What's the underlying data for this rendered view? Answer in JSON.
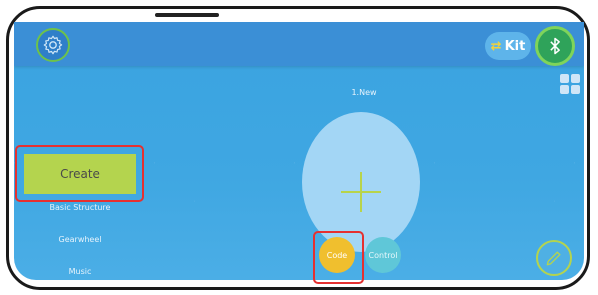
{
  "topbar": {
    "settings_icon": "gear-icon",
    "kit_label": "Kit",
    "kit_icon": "swap-arrows-icon",
    "bluetooth_icon": "bluetooth-icon",
    "layout_icon": "grid-icon"
  },
  "project": {
    "title": "1.New",
    "add_icon": "plus-icon"
  },
  "sidebar": {
    "create_label": "Create",
    "items": [
      {
        "label": "Basic Structure"
      },
      {
        "label": "Gearwheel"
      },
      {
        "label": "Music"
      }
    ]
  },
  "modes": {
    "code_label": "Code",
    "control_label": "Control"
  },
  "tools": {
    "edit_icon": "pencil-icon"
  },
  "colors": {
    "screen_bg": "#3fa7e2",
    "topbar_bg": "#3b8fd6",
    "accent_green": "#b4d44e",
    "code_yellow": "#f0bf2e",
    "control_teal": "#5fc7d8",
    "highlight_red": "#e53030"
  }
}
